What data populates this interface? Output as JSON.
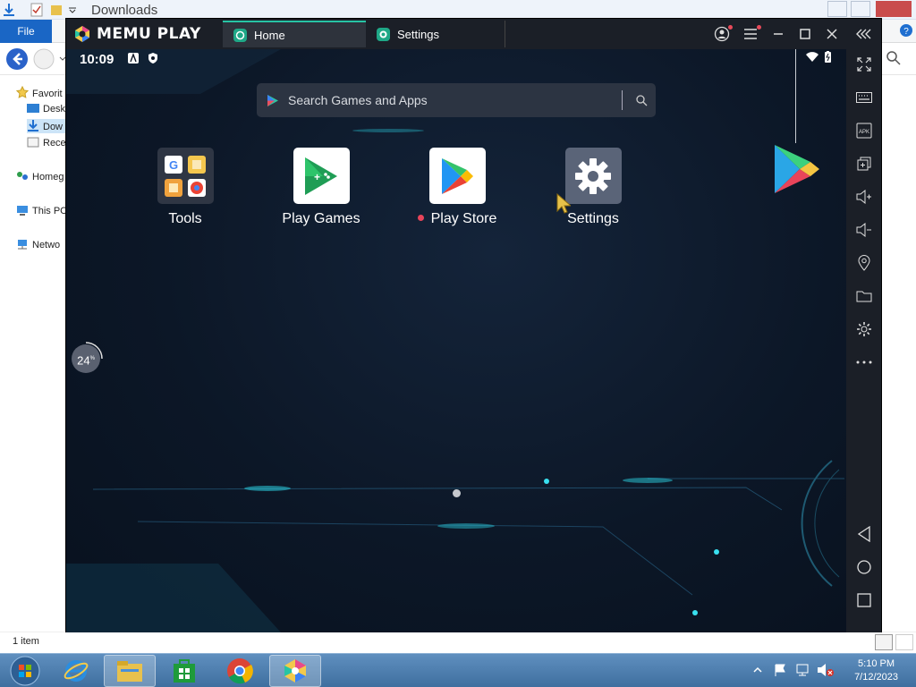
{
  "explorer": {
    "title": "Downloads",
    "file_tab": "File",
    "nav": {
      "favorites": "Favorit",
      "desktop": "Desk",
      "downloads": "Dow",
      "recent": "Rece",
      "homegroup": "Homeg",
      "this_pc": "This PC",
      "network": "Netwo"
    },
    "status": "1 item"
  },
  "memu": {
    "brand": "MEMU PLAY",
    "tabs": [
      {
        "label": "Home"
      },
      {
        "label": "Settings"
      }
    ],
    "status_time": "10:09",
    "search_placeholder": "Search Games and Apps",
    "apps": [
      {
        "label": "Tools"
      },
      {
        "label": "Play Games"
      },
      {
        "label": "Play Store"
      },
      {
        "label": "Settings"
      }
    ],
    "progress": "24",
    "progress_unit": "%"
  },
  "taskbar": {
    "time": "5:10 PM",
    "date": "7/12/2023"
  },
  "colors": {
    "memu_bg": "#0d1523",
    "accent": "#27c4a4",
    "taskbar": "#4f7faf"
  }
}
